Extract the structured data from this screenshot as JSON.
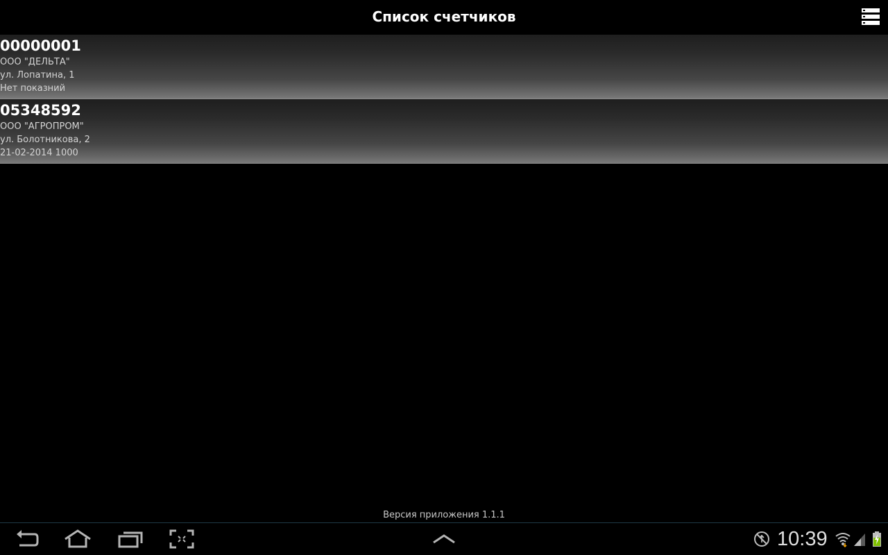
{
  "action_bar": {
    "title": "Список счетчиков",
    "menu_icon": "list-menu-icon"
  },
  "meters": [
    {
      "number": "00000001",
      "organization": "ООО \"ДЕЛЬТА\"",
      "address": "ул. Лопатина, 1",
      "reading": "Нет показний"
    },
    {
      "number": "05348592",
      "organization": "ООО \"АГРОПРОМ\"",
      "address": "ул. Болотникова, 2",
      "reading": "21-02-2014 1000"
    }
  ],
  "footer": {
    "version": "Версия приложения 1.1.1"
  },
  "nav_bar": {
    "buttons": [
      "back-icon",
      "home-icon",
      "recent-apps-icon",
      "screenshot-icon",
      "chevron-up-icon"
    ]
  },
  "status_bar": {
    "time": "10:39",
    "icons": [
      "usb-debug-icon",
      "wifi-icon",
      "signal-icon",
      "battery-icon"
    ]
  },
  "colors": {
    "background": "#000000",
    "item_gradient_top": "#1e1e1e",
    "item_gradient_bottom": "#7a7a7a",
    "nav_border": "#1f3a46"
  }
}
